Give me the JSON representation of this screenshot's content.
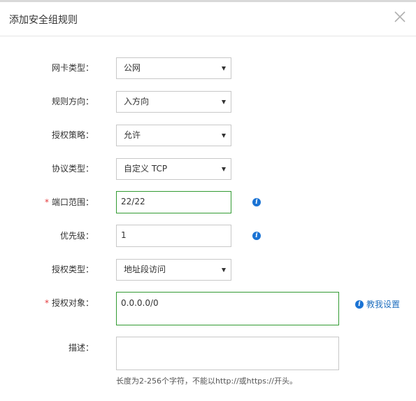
{
  "dialog": {
    "title": "添加安全组规则"
  },
  "form": {
    "nic_type": {
      "label": "网卡类型：",
      "value": "公网"
    },
    "direction": {
      "label": "规则方向：",
      "value": "入方向"
    },
    "policy": {
      "label": "授权策略：",
      "value": "允许"
    },
    "protocol": {
      "label": "协议类型：",
      "value": "自定义 TCP"
    },
    "port_range": {
      "label": "端口范围：",
      "value": "22/22",
      "required_mark": "*"
    },
    "priority": {
      "label": "优先级：",
      "value": "1"
    },
    "auth_type": {
      "label": "授权类型：",
      "value": "地址段访问"
    },
    "auth_object": {
      "label": "授权对象：",
      "value": "0.0.0.0/0",
      "required_mark": "*",
      "help_link": "教我设置"
    },
    "description": {
      "label": "描述：",
      "value": "",
      "hint": "长度为2-256个字符，不能以http://或https://开头。"
    }
  },
  "icons": {
    "info": "info-icon",
    "close": "close-icon",
    "dropdown": "chevron-down-icon"
  },
  "colors": {
    "focus_border": "#339b33",
    "required": "#e4393c",
    "link": "#1f6fbf",
    "info": "#1a73d4"
  }
}
